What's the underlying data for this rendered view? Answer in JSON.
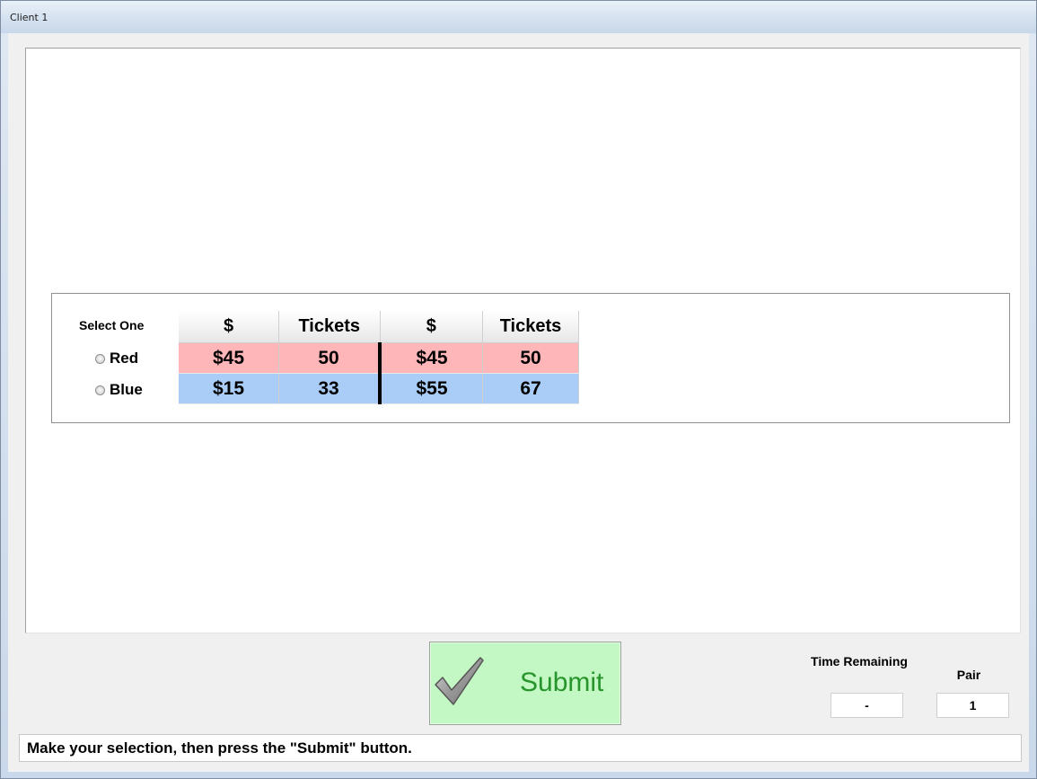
{
  "window": {
    "title": "Client 1"
  },
  "selection": {
    "prompt": "Select One",
    "options": [
      {
        "label": "Red",
        "selected": false,
        "color": "#ffb6b9"
      },
      {
        "label": "Blue",
        "selected": false,
        "color": "#a9cdf6"
      }
    ]
  },
  "table": {
    "headers": [
      "$",
      "Tickets",
      "$",
      "Tickets"
    ],
    "rows": [
      [
        "$45",
        "50",
        "$45",
        "50"
      ],
      [
        "$15",
        "33",
        "$55",
        "67"
      ]
    ]
  },
  "submit": {
    "label": "Submit",
    "icon": "checkmark-icon",
    "color": "#c3f7c4"
  },
  "time": {
    "label": "Time Remaining",
    "value": "-"
  },
  "pair": {
    "label": "Pair",
    "value": "1"
  },
  "status": {
    "message": "Make your selection, then press the \"Submit\" button."
  }
}
